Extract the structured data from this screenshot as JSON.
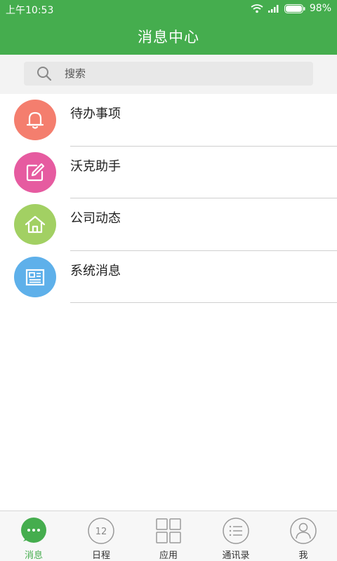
{
  "status_bar": {
    "time": "上午10:53",
    "battery": "98%"
  },
  "header": {
    "title": "消息中心"
  },
  "search": {
    "placeholder": "搜索"
  },
  "items": [
    {
      "label": "待办事项",
      "icon": "bell-icon",
      "color": "#f47e6e"
    },
    {
      "label": "沃克助手",
      "icon": "edit-icon",
      "color": "#e65ba0"
    },
    {
      "label": "公司动态",
      "icon": "home-icon",
      "color": "#a2d063"
    },
    {
      "label": "系统消息",
      "icon": "news-icon",
      "color": "#5eb0ea"
    }
  ],
  "tabs": [
    {
      "label": "消息",
      "icon": "chat-icon",
      "active": true
    },
    {
      "label": "日程",
      "icon": "calendar-icon",
      "badge": "12"
    },
    {
      "label": "应用",
      "icon": "apps-grid-icon"
    },
    {
      "label": "通讯录",
      "icon": "contacts-list-icon"
    },
    {
      "label": "我",
      "icon": "profile-icon"
    }
  ],
  "colors": {
    "brand": "#45ad4e"
  }
}
